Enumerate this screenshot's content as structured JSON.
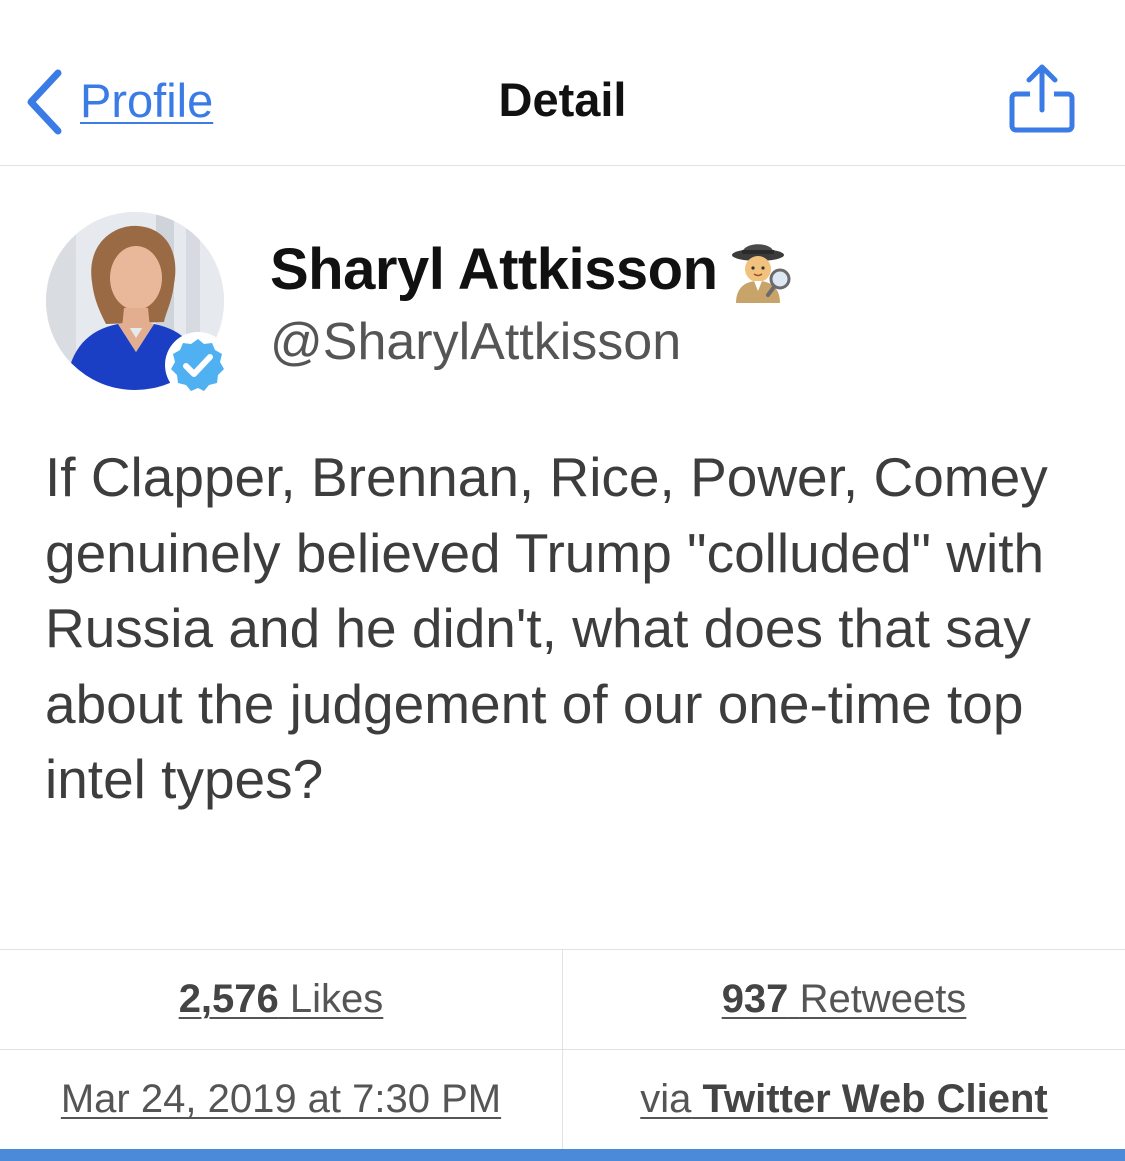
{
  "nav": {
    "back_label": "Profile",
    "title": "Detail"
  },
  "tweet": {
    "author_name": "Sharyl Attkisson",
    "author_handle": "@SharylAttkisson",
    "text": "If Clapper, Brennan, Rice, Power, Comey genuinely believed Trump \"colluded\" with Russia and he didn't, what does that say about the judgement of our one-time top intel types?",
    "likes_count": "2,576",
    "likes_label": "Likes",
    "retweets_count": "937",
    "retweets_label": "Retweets",
    "timestamp": "Mar 24, 2019 at 7:30 PM",
    "source_prefix": "via",
    "source_name": "Twitter Web Client"
  },
  "icons": {
    "back": "chevron-left-icon",
    "share": "share-icon",
    "verified": "verified-badge-icon",
    "name_emoji": "detective-emoji"
  },
  "colors": {
    "accent": "#3a7be6",
    "verified": "#4fb1f2",
    "bottom_bar": "#4a8ad8"
  }
}
